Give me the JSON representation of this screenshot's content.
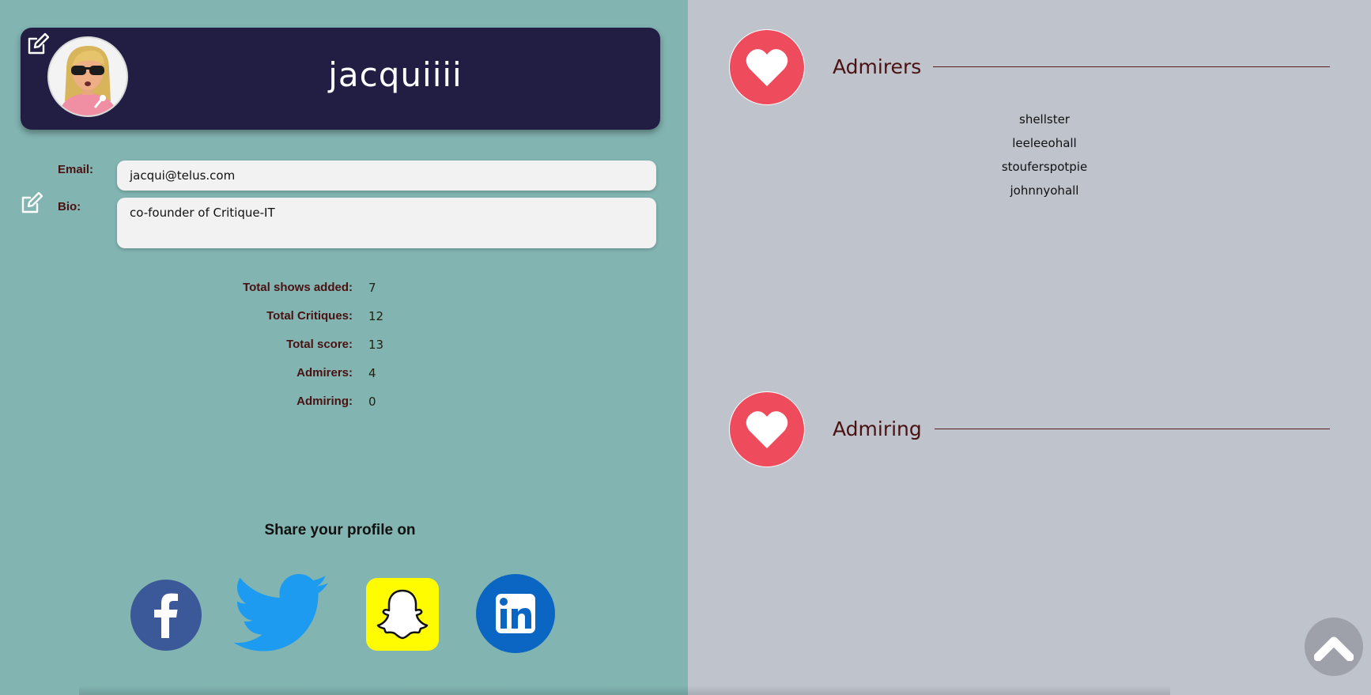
{
  "profile": {
    "username": "jacquiiii",
    "email_label": "Email:",
    "email_value": "jacqui@telus.com",
    "bio_label": "Bio:",
    "bio_value": "co-founder of Critique-IT"
  },
  "stats": [
    {
      "label": "Total shows added:",
      "value": "7"
    },
    {
      "label": "Total Critiques:",
      "value": "12"
    },
    {
      "label": "Total score:",
      "value": "13"
    },
    {
      "label": "Admirers:",
      "value": "4"
    },
    {
      "label": "Admiring:",
      "value": "0"
    }
  ],
  "share": {
    "heading": "Share your profile on",
    "networks": [
      "facebook-icon",
      "twitter-icon",
      "snapchat-icon",
      "linkedin-icon"
    ]
  },
  "admirers": {
    "title": "Admirers",
    "items": [
      "shellster",
      "leeleeohall",
      "stouferspotpie",
      "johnnyohall"
    ]
  },
  "admiring": {
    "title": "Admiring",
    "items": []
  },
  "colors": {
    "left_bg": "#82b4b1",
    "right_bg": "#bec3cc",
    "header_bg": "#221e43",
    "heart_red": "#ee4b5d",
    "label_maroon": "#4a1111",
    "facebook": "#3b5998",
    "twitter": "#1d9bf0",
    "snapchat": "#fffc00",
    "linkedin": "#0a66c2"
  }
}
